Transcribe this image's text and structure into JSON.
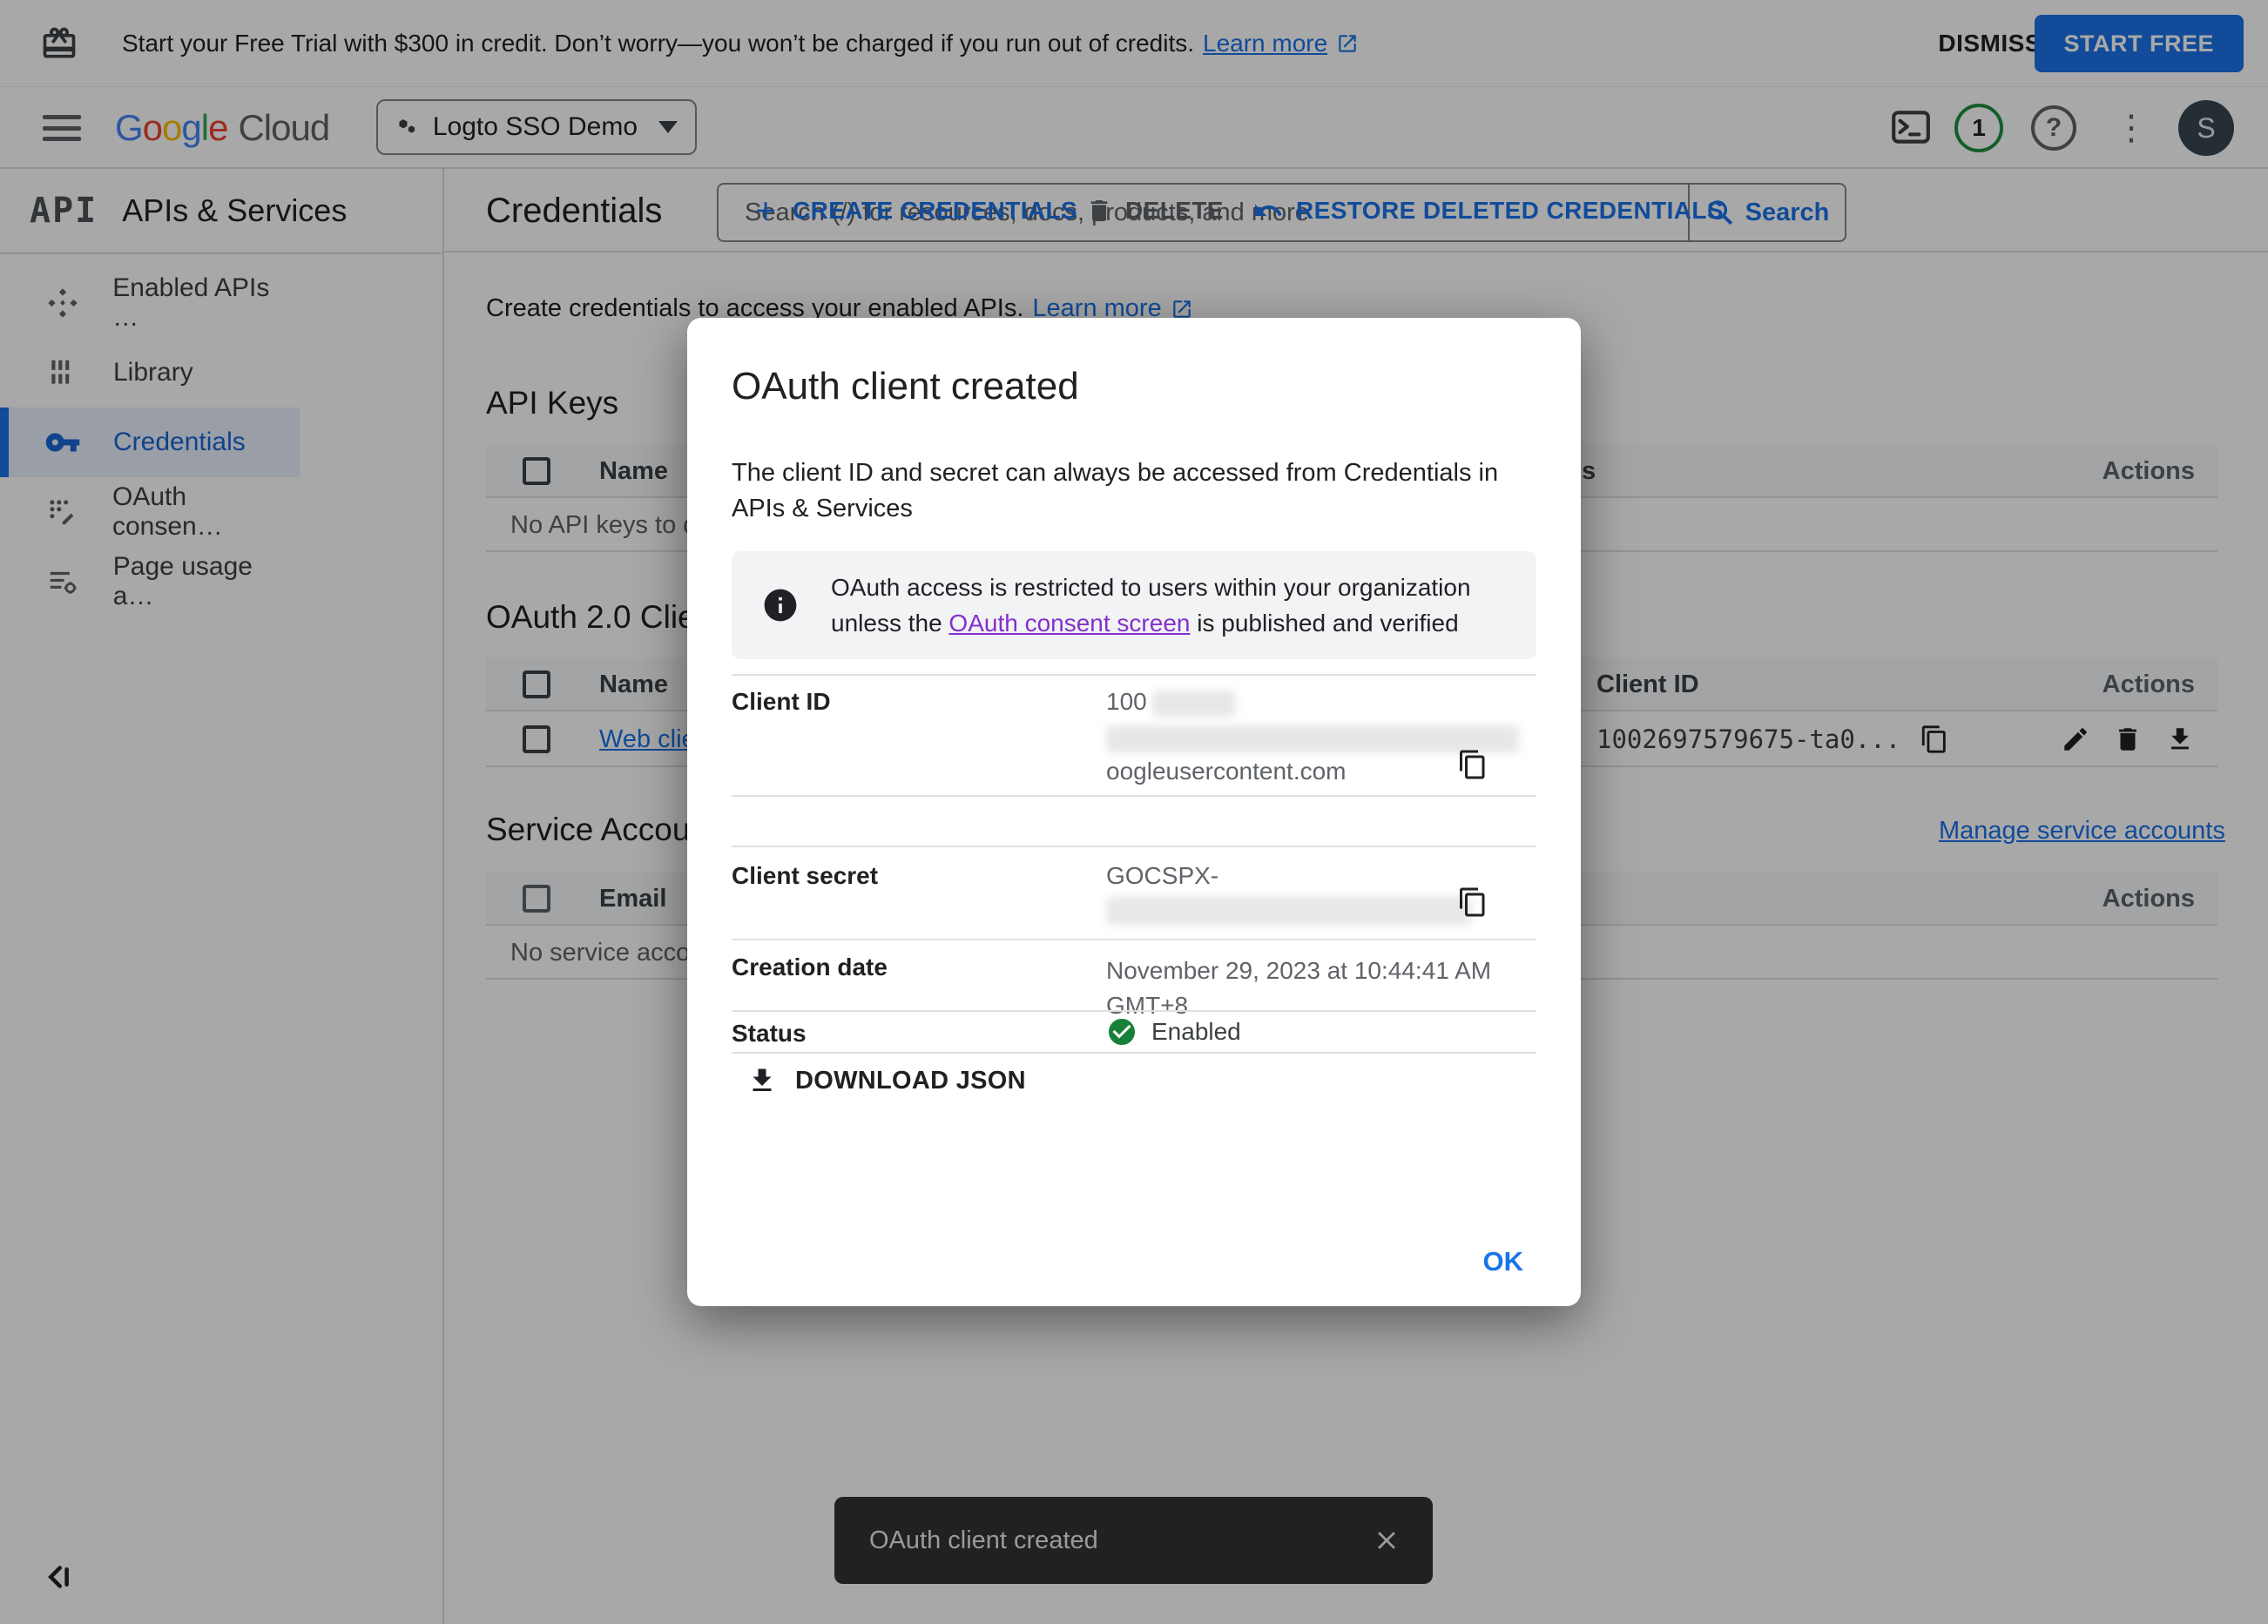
{
  "colors": {
    "accent_blue": "#1a73e8",
    "active_nav_blue": "#1967d2",
    "success_green": "#188038",
    "scrim": "rgba(0,0,0,0.34)",
    "toast_bg": "#323232",
    "consent_link_purple": "#8430ce"
  },
  "banner": {
    "text": "Start your Free Trial with $300 in credit. Don’t worry—you won’t be charged if you run out of credits.",
    "learn_more": "Learn more",
    "dismiss": "DISMISS",
    "start_free": "START FREE"
  },
  "header": {
    "logo_google": "Google",
    "logo_cloud": "Cloud",
    "project": "Logto SSO Demo",
    "search_placeholder": "Search (/) for resources, docs, products, and more",
    "search_button": "Search",
    "notification_count": "1",
    "avatar_initial": "S"
  },
  "sidebar": {
    "brand": "API",
    "title": "APIs & Services",
    "items": [
      {
        "label": "Enabled APIs …"
      },
      {
        "label": "Library"
      },
      {
        "label": "Credentials"
      },
      {
        "label": "OAuth consen…"
      },
      {
        "label": "Page usage a…"
      }
    ]
  },
  "toolbar": {
    "title": "Credentials",
    "create": "CREATE CREDENTIALS",
    "delete": "DELETE",
    "restore": "RESTORE DELETED CREDENTIALS"
  },
  "content": {
    "intro": "Create credentials to access your enabled APIs.",
    "intro_link": "Learn more",
    "api_keys": {
      "title": "API Keys",
      "col_name": "Name",
      "col_partial": "s",
      "col_actions": "Actions",
      "empty": "No API keys to di"
    },
    "oauth_clients": {
      "title": "OAuth 2.0 Clie",
      "col_name": "Name",
      "col_client_id": "Client ID",
      "col_actions": "Actions",
      "row_name": "Web clier",
      "row_client_id": "1002697579675-ta0..."
    },
    "service_accounts": {
      "title": "Service Accou",
      "manage_link": "Manage service accounts",
      "col_email": "Email",
      "col_actions": "Actions",
      "empty": "No service accou"
    }
  },
  "modal": {
    "title": "OAuth client created",
    "description": "The client ID and secret can always be accessed from Credentials in APIs & Services",
    "info_line1": "OAuth access is restricted to users within your organization",
    "info_line2_pre": "unless the ",
    "info_link": "OAuth consent screen",
    "info_line2_post": " is published and verified",
    "client_id_label": "Client ID",
    "client_id_prefix": "100",
    "client_id_suffix": "oogleusercontent.com",
    "client_secret_label": "Client secret",
    "client_secret_prefix": "GOCSPX-",
    "creation_date_label": "Creation date",
    "creation_date_value": "November 29, 2023 at 10:44:41 AM GMT+8",
    "status_label": "Status",
    "status_value": "Enabled",
    "download": "DOWNLOAD JSON",
    "ok": "OK"
  },
  "toast": {
    "message": "OAuth client created"
  }
}
